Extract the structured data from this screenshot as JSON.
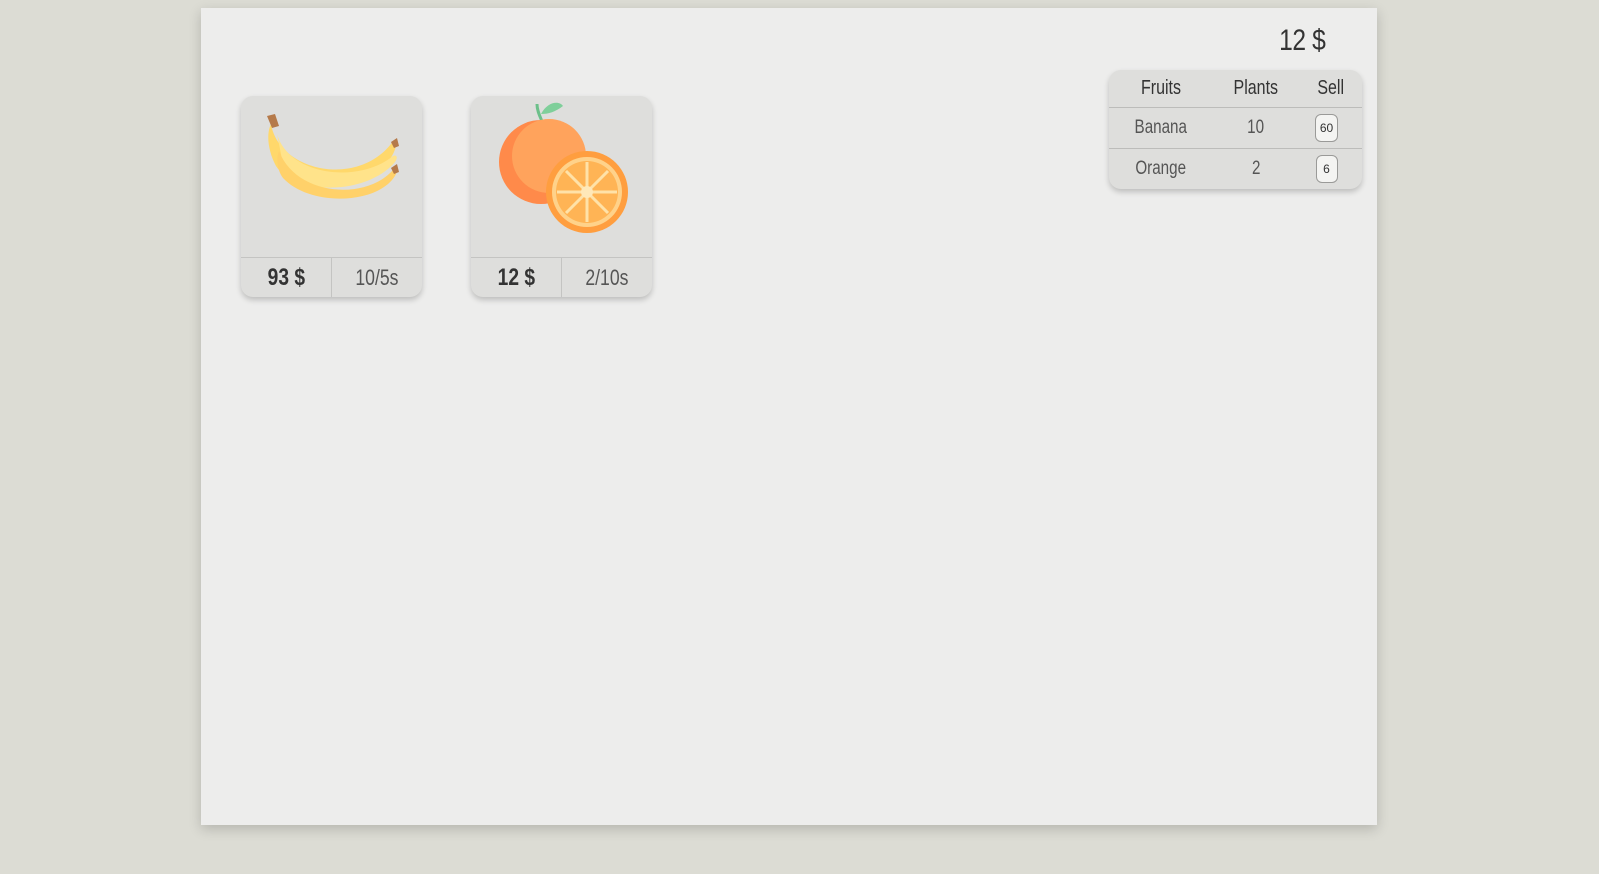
{
  "money": "12 $",
  "shop": [
    {
      "name": "Banana",
      "icon": "banana-icon",
      "price": "93 $",
      "rate": "10/5s"
    },
    {
      "name": "Orange",
      "icon": "orange-icon",
      "price": "12 $",
      "rate": "2/10s"
    }
  ],
  "stats": {
    "headers": {
      "fruits": "Fruits",
      "plants": "Plants",
      "sell": "Sell"
    },
    "rows": [
      {
        "fruit": "Banana",
        "plants": "10",
        "sell": "60"
      },
      {
        "fruit": "Orange",
        "plants": "2",
        "sell": "6"
      }
    ]
  },
  "colors": {
    "background": "#dcdcd4",
    "panel": "#ededec",
    "card": "#dededc",
    "banana": "#ffd86b",
    "orange": "#ff9e4a"
  }
}
